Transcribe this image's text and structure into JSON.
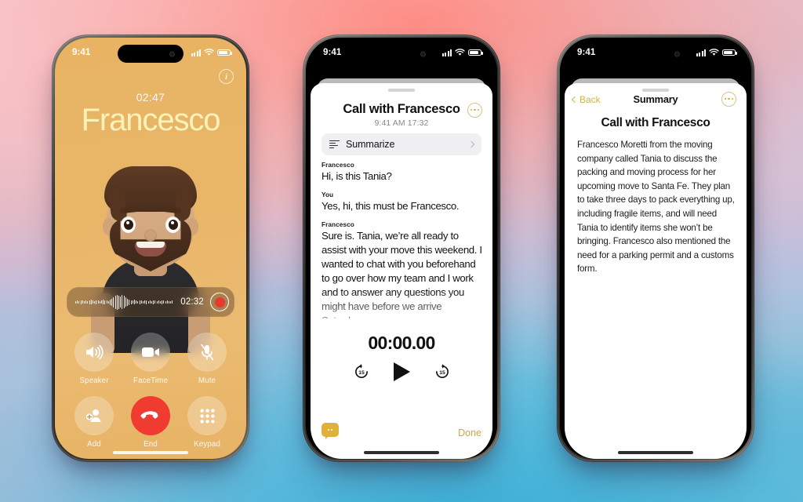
{
  "scene": {
    "background_colors": [
      "#f6c9cf",
      "#f4a9a5",
      "#c3b8d6",
      "#45a9d2"
    ]
  },
  "phone1": {
    "status": {
      "time": "9:41",
      "signal_icon": "cellular-signal-icon",
      "wifi_icon": "wifi-icon",
      "battery_icon": "battery-icon"
    },
    "info_icon": "info-icon",
    "call_timer": "02:47",
    "caller_name": "Francesco",
    "accent_color": "#e8b464",
    "name_color": "#fdf3ba",
    "avatar": "memoji-avatar",
    "recording": {
      "waveform_icon": "audio-waveform",
      "elapsed": "02:32",
      "record_button_icon": "record-stop-icon",
      "record_color": "#e8392e"
    },
    "controls": [
      {
        "label": "Speaker",
        "icon": "speaker-icon"
      },
      {
        "label": "FaceTime",
        "icon": "video-camera-icon"
      },
      {
        "label": "Mute",
        "icon": "microphone-muted-icon"
      },
      {
        "label": "Add",
        "icon": "add-person-icon"
      },
      {
        "label": "End",
        "icon": "end-call-icon"
      },
      {
        "label": "Keypad",
        "icon": "keypad-icon"
      }
    ],
    "end_button_color": "#ef3b30"
  },
  "phone2": {
    "status": {
      "time": "9:41"
    },
    "title": "Call with Francesco",
    "subtitle": "9:41 AM  17:32",
    "more_icon": "more-options-icon",
    "summarize": {
      "label": "Summarize",
      "icon": "summarize-lines-icon",
      "chevron_icon": "chevron-right-icon"
    },
    "transcript": [
      {
        "speaker": "Francesco",
        "text": "Hi, is this Tania?",
        "faded": false
      },
      {
        "speaker": "You",
        "text": "Yes, hi, this must be Francesco.",
        "faded": false
      },
      {
        "speaker": "Francesco",
        "text": "Sure is. Tania, we’re all ready to assist with your move this weekend. I wanted to chat with you beforehand to go over how my team and I work and to answer any questions you might have before we arrive Saturday",
        "faded": true
      }
    ],
    "player": {
      "time": "00:00.00",
      "back_label": "15",
      "forward_label": "15",
      "back_icon": "skip-back-15-icon",
      "play_icon": "play-icon",
      "forward_icon": "skip-forward-15-icon"
    },
    "message_icon": "message-bubble-icon",
    "message_color": "#dfb13a",
    "done_label": "Done",
    "done_color": "#cfa73c"
  },
  "phone3": {
    "status": {
      "time": "9:41"
    },
    "back_label": "Back",
    "back_icon": "chevron-left-icon",
    "nav_title": "Summary",
    "more_icon": "more-options-icon",
    "heading": "Call with Francesco",
    "body": "Francesco Moretti from the moving company called Tania to discuss the packing and moving process for her upcoming move to Santa Fe. They plan to take three days to pack everything up, including fragile items, and will need Tania to identify items she won’t be bringing. Francesco also mentioned the need for a parking permit and a customs form.",
    "accent_color": "#d4b24a"
  }
}
